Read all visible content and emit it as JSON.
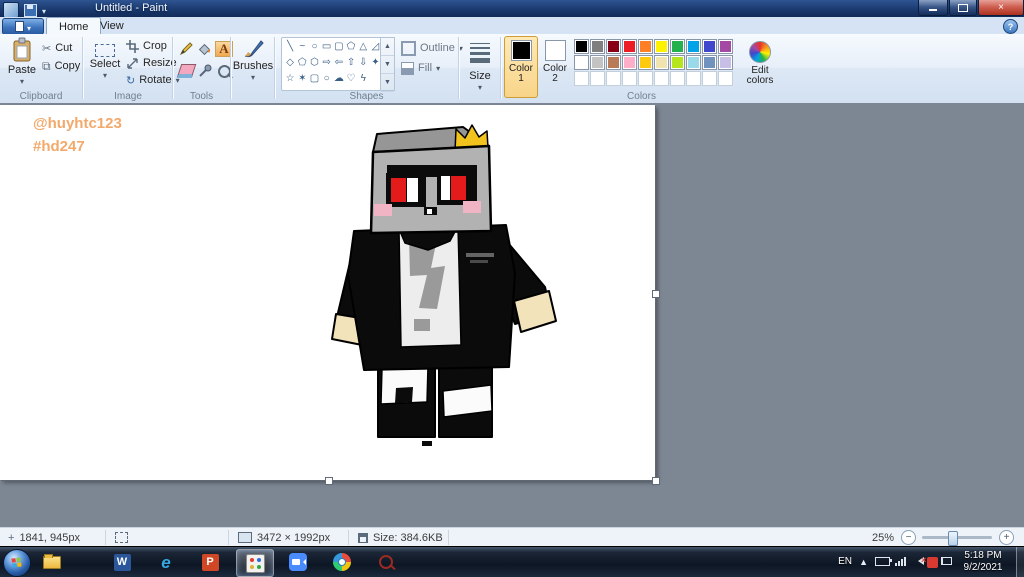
{
  "titlebar": {
    "title": "Untitled - Paint"
  },
  "ribbon": {
    "tabs": [
      {
        "label": "Home",
        "active": true
      },
      {
        "label": "View",
        "active": false
      }
    ],
    "clipboard": {
      "group_label": "Clipboard",
      "paste_label": "Paste",
      "cut_label": "Cut",
      "copy_label": "Copy"
    },
    "image": {
      "group_label": "Image",
      "select_label": "Select",
      "crop_label": "Crop",
      "resize_label": "Resize",
      "rotate_label": "Rotate"
    },
    "tools": {
      "group_label": "Tools"
    },
    "brushes": {
      "label": "Brushes"
    },
    "shapes": {
      "group_label": "Shapes",
      "outline_label": "Outline",
      "fill_label": "Fill",
      "gallery": [
        {
          "name": "line",
          "glyph": "╲"
        },
        {
          "name": "curve",
          "glyph": "~"
        },
        {
          "name": "ellipse",
          "glyph": "○"
        },
        {
          "name": "rectangle",
          "glyph": "▭"
        },
        {
          "name": "rounded-rectangle",
          "glyph": "▢"
        },
        {
          "name": "polygon",
          "glyph": "⬠"
        },
        {
          "name": "triangle",
          "glyph": "△"
        },
        {
          "name": "right-triangle",
          "glyph": "◿"
        },
        {
          "name": "diamond",
          "glyph": "◇"
        },
        {
          "name": "pentagon",
          "glyph": "⬠"
        },
        {
          "name": "hexagon",
          "glyph": "⬡"
        },
        {
          "name": "arrow-right",
          "glyph": "⇨"
        },
        {
          "name": "arrow-left",
          "glyph": "⇦"
        },
        {
          "name": "arrow-up",
          "glyph": "⇧"
        },
        {
          "name": "arrow-down",
          "glyph": "⇩"
        },
        {
          "name": "star-4",
          "glyph": "✦"
        },
        {
          "name": "star-5",
          "glyph": "☆"
        },
        {
          "name": "star-6",
          "glyph": "✶"
        },
        {
          "name": "callout-rounded",
          "glyph": "▢"
        },
        {
          "name": "callout-oval",
          "glyph": "○"
        },
        {
          "name": "callout-cloud",
          "glyph": "☁"
        },
        {
          "name": "heart",
          "glyph": "♡"
        },
        {
          "name": "lightning",
          "glyph": "ϟ"
        }
      ]
    },
    "size": {
      "label": "Size"
    },
    "colors": {
      "group_label": "Colors",
      "color1_label": "Color 1",
      "color1_value": "#000000",
      "color2_label": "Color 2",
      "color2_value": "#ffffff",
      "edit_colors_label": "Edit colors",
      "palette": [
        "#000000",
        "#7f7f7f",
        "#880015",
        "#ed1c24",
        "#ff7f27",
        "#fff200",
        "#22b14c",
        "#00a2e8",
        "#3f48cc",
        "#a349a4",
        "#ffffff",
        "#c3c3c3",
        "#b97a57",
        "#ffaec9",
        "#ffc90e",
        "#efe4b0",
        "#b5e61d",
        "#99d9ea",
        "#7092be",
        "#c8bfe7",
        "",
        "",
        "",
        "",
        "",
        "",
        "",
        "",
        "",
        ""
      ]
    }
  },
  "canvas": {
    "signature_line1": "@huyhtc123",
    "signature_line2": "#hd247",
    "signature_color": "#f2a96b",
    "character_palette": {
      "head": "#b2b2b2",
      "head_top": "#969696",
      "crown": "#f2c21d",
      "eye_red": "#e31b1b",
      "blush": "#f0b4c4",
      "robe": "#0b0b0b",
      "hands": "#f2e3ba",
      "scarf": "#ededed",
      "scarf_pattern": "#9a9a9a"
    }
  },
  "statusbar": {
    "cursor_position": "1841, 945px",
    "image_dimensions": "3472 × 1992px",
    "file_size": "Size: 384.6KB",
    "zoom_level": "25%"
  },
  "taskbar": {
    "tray": {
      "language": "EN",
      "time": "5:18 PM",
      "date": "9/2/2021"
    }
  }
}
